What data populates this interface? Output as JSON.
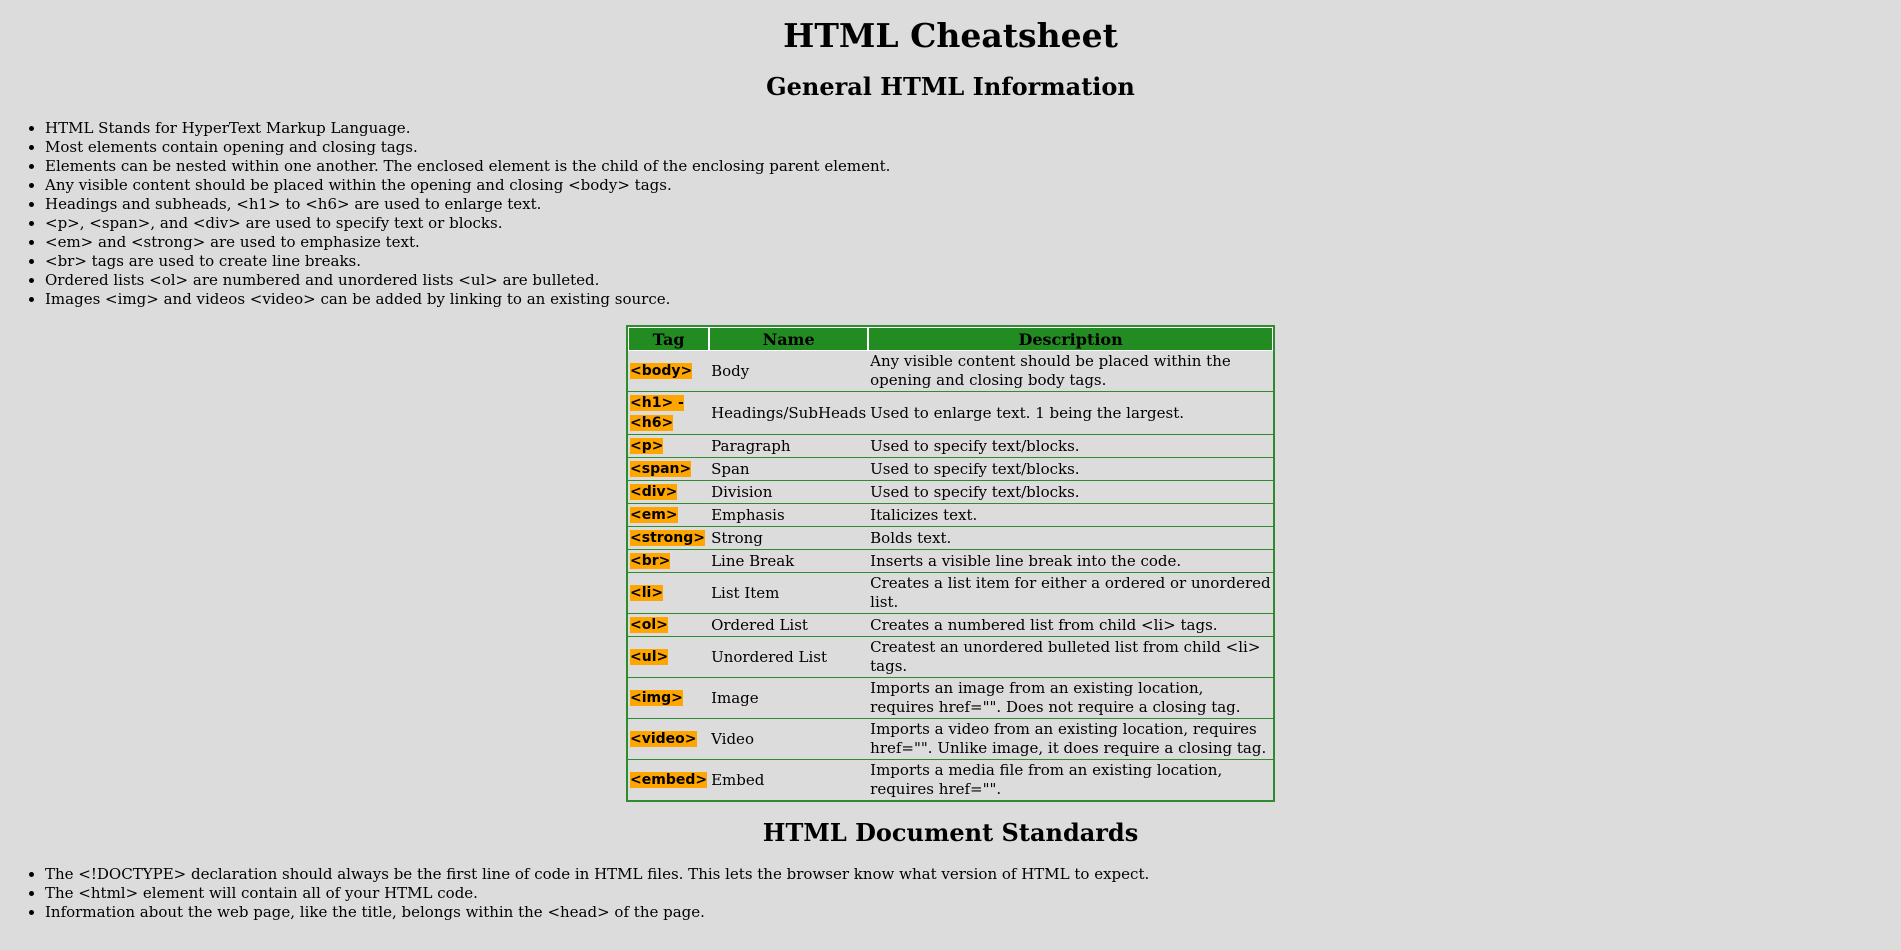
{
  "page_title": "HTML Cheatsheet",
  "general": {
    "heading": "General HTML Information",
    "items": [
      "HTML Stands for HyperText Markup Language.",
      "Most elements contain opening and closing tags.",
      "Elements can be nested within one another. The enclosed element is the child of the enclosing parent element.",
      "Any visible content should be placed within the opening and closing <body> tags.",
      "Headings and subheads, <h1> to <h6> are used to enlarge text.",
      "<p>, <span>, and <div> are used to specify text or blocks.",
      "<em> and <strong> are used to emphasize text.",
      "<br> tags are used to create line breaks.",
      "Ordered lists <ol> are numbered and unordered lists <ul> are bulleted.",
      "Images <img> and videos <video> can be added by linking to an existing source."
    ]
  },
  "table": {
    "headers": [
      "Tag",
      "Name",
      "Description"
    ],
    "rows": [
      {
        "tag": "<body>",
        "name": "Body",
        "description": "Any visible content should be placed within the opening and closing body tags."
      },
      {
        "tag": "<h1> - <h6>",
        "name": "Headings/SubHeads",
        "description": "Used to enlarge text. 1 being the largest."
      },
      {
        "tag": "<p>",
        "name": "Paragraph",
        "description": "Used to specify text/blocks."
      },
      {
        "tag": "<span>",
        "name": "Span",
        "description": "Used to specify text/blocks."
      },
      {
        "tag": "<div>",
        "name": "Division",
        "description": "Used to specify text/blocks."
      },
      {
        "tag": "<em>",
        "name": "Emphasis",
        "description": "Italicizes text."
      },
      {
        "tag": "<strong>",
        "name": "Strong",
        "description": "Bolds text."
      },
      {
        "tag": "<br>",
        "name": "Line Break",
        "description": "Inserts a visible line break into the code."
      },
      {
        "tag": "<li>",
        "name": "List Item",
        "description": "Creates a list item for either a ordered or unordered list."
      },
      {
        "tag": "<ol>",
        "name": "Ordered List",
        "description": "Creates a numbered list from child <li> tags."
      },
      {
        "tag": "<ul>",
        "name": "Unordered List",
        "description": "Createst an unordered bulleted list from child <li> tags."
      },
      {
        "tag": "<img>",
        "name": "Image",
        "description": "Imports an image from an existing location, requires href=\"\". Does not require a closing tag."
      },
      {
        "tag": "<video>",
        "name": "Video",
        "description": "Imports a video from an existing location, requires href=\"\". Unlike image, it does require a closing tag."
      },
      {
        "tag": "<embed>",
        "name": "Embed",
        "description": "Imports a media file from an existing location, requires href=\"\"."
      }
    ]
  },
  "standards": {
    "heading": "HTML Document Standards",
    "items": [
      "The <!DOCTYPE> declaration should always be the first line of code in HTML files. This lets the browser know what version of HTML to expect.",
      "The <html> element will contain all of your HTML code.",
      "Information about the web page, like the title, belongs within the <head> of the page."
    ]
  },
  "colors": {
    "background": "#dcdcdc",
    "table_header": "#228b22",
    "table_border": "#2e8b2e",
    "tag_highlight": "#ffa500"
  }
}
